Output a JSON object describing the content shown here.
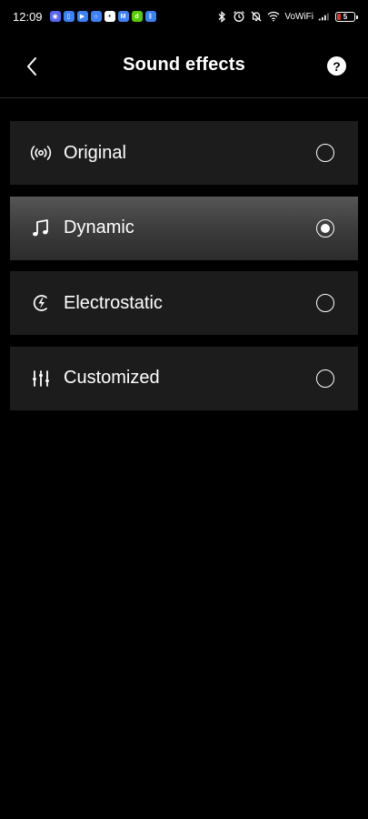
{
  "status_bar": {
    "time": "12:09",
    "network_label": "VoWiFi",
    "battery_level": "5",
    "notification_icons": [
      {
        "name": "discord-icon",
        "color": "#5865f2",
        "glyph": "◉"
      },
      {
        "name": "files-icon",
        "color": "#3b82f6",
        "glyph": "▯"
      },
      {
        "name": "youtube-icon",
        "color": "#3b82f6",
        "glyph": "▶"
      },
      {
        "name": "headphones-icon",
        "color": "#3b82f6",
        "glyph": "∩"
      },
      {
        "name": "app-icon",
        "color": "#ffffff",
        "glyph": "•"
      },
      {
        "name": "mail-icon",
        "color": "#3b82f6",
        "glyph": "M"
      },
      {
        "name": "duolingo-icon",
        "color": "#58cc02",
        "glyph": "d"
      },
      {
        "name": "bluetooth-app-icon",
        "color": "#3b82f6",
        "glyph": "ᛒ"
      }
    ]
  },
  "header": {
    "title": "Sound effects",
    "help_glyph": "?"
  },
  "options": [
    {
      "key": "original",
      "label": "Original",
      "icon": "broadcast-icon",
      "selected": false
    },
    {
      "key": "dynamic",
      "label": "Dynamic",
      "icon": "music-note-icon",
      "selected": true
    },
    {
      "key": "electrostatic",
      "label": "Electrostatic",
      "icon": "lightning-icon",
      "selected": false
    },
    {
      "key": "customized",
      "label": "Customized",
      "icon": "equalizer-icon",
      "selected": false
    }
  ],
  "colors": {
    "background": "#000000",
    "card": "#1c1c1c",
    "selected_card": "#3c3c3c",
    "text": "#ffffff",
    "battery_low": "#e0352b"
  }
}
